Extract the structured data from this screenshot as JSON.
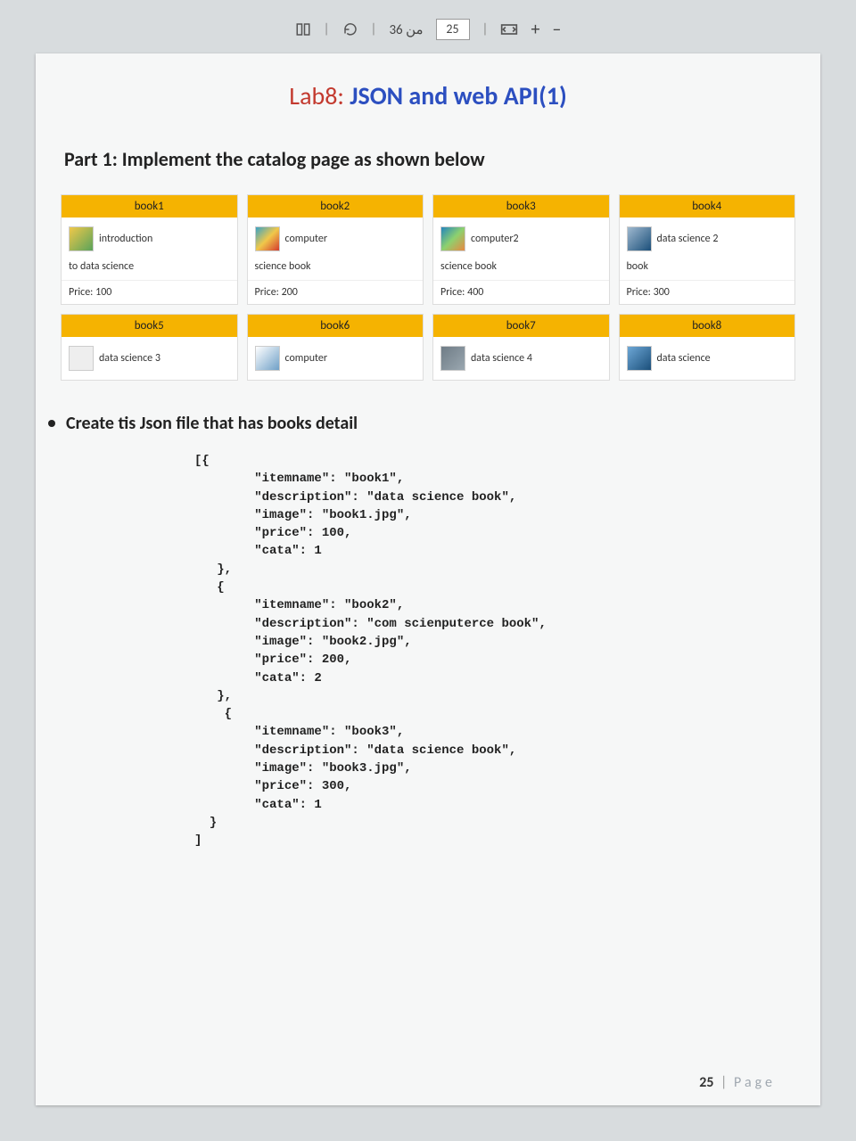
{
  "toolbar": {
    "page_total": "من 36",
    "page_current": "25",
    "plus": "+",
    "minus": "–"
  },
  "title": {
    "label": "Lab8:",
    "subject": "JSON and web API(1)"
  },
  "part1_heading": "Part 1: Implement the catalog page as shown below",
  "books": [
    {
      "head": "book1",
      "desc": "introduction",
      "sub": "to data science",
      "price": "Price: 100"
    },
    {
      "head": "book2",
      "desc": "computer",
      "sub": "science book",
      "price": "Price: 200"
    },
    {
      "head": "book3",
      "desc": "computer2",
      "sub": "science book",
      "price": "Price: 400"
    },
    {
      "head": "book4",
      "desc": "data science 2",
      "sub": "book",
      "price": "Price: 300"
    },
    {
      "head": "book5",
      "desc": "data science 3"
    },
    {
      "head": "book6",
      "desc": "computer"
    },
    {
      "head": "book7",
      "desc": "data science 4"
    },
    {
      "head": "book8",
      "desc": "data science"
    }
  ],
  "bullet": "Create tis Json file that has books detail",
  "code": "[{\n        \"itemname\": \"book1\",\n        \"description\": \"data science book\",\n        \"image\": \"book1.jpg\",\n        \"price\": 100,\n        \"cata\": 1\n   },\n   {\n        \"itemname\": \"book2\",\n        \"description\": \"com scienputerce book\",\n        \"image\": \"book2.jpg\",\n        \"price\": 200,\n        \"cata\": 2\n   },\n    {\n        \"itemname\": \"book3\",\n        \"description\": \"data science book\",\n        \"image\": \"book3.jpg\",\n        \"price\": 300,\n        \"cata\": 1\n  }\n]",
  "footer": {
    "pagenum": "25",
    "sep": "|",
    "label": "Page"
  }
}
